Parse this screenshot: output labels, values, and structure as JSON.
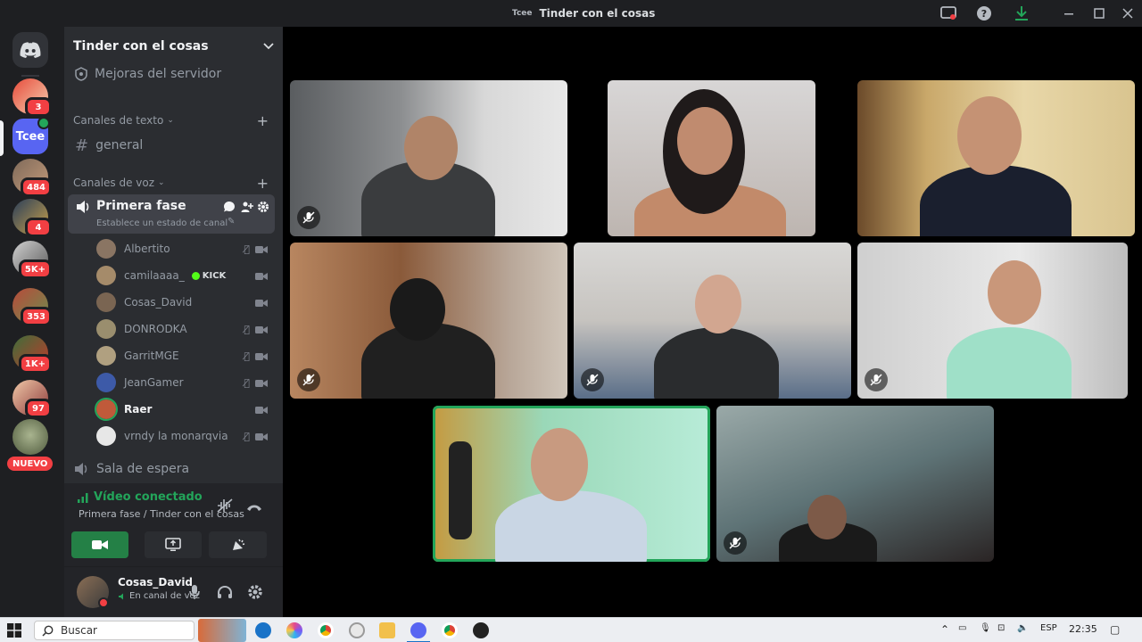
{
  "window": {
    "title": "Tinder con el cosas",
    "title_logo": "Tcee"
  },
  "rail": {
    "servers": [
      {
        "badge": "3",
        "color": "#c0392b"
      },
      {
        "label": "Tcee",
        "color": "#5865f2",
        "active": true
      },
      {
        "badge": "484",
        "color": "#7f6a5a"
      },
      {
        "badge": "4",
        "color": "#4f6f9a"
      },
      {
        "badge": "5K+",
        "color": "#a9a9a9"
      },
      {
        "badge": "353",
        "color": "#6b8e4e"
      },
      {
        "badge": "1K+",
        "color": "#3e6e3a"
      },
      {
        "badge": "97",
        "color": "#8b3a3a"
      },
      {
        "color": "#7d8a6a"
      }
    ],
    "new_label": "NUEVO"
  },
  "sidebar": {
    "server_name": "Tinder con el cosas",
    "boost": "Mejoras del servidor",
    "text_category": "Canales de texto",
    "text_channel": "general",
    "voice_category": "Canales de voz",
    "voice_channel": "Primera fase",
    "voice_status_prompt": "Establece un estado de canal",
    "voice_users": [
      {
        "name": "Albertito",
        "color": "#8a7563",
        "muted": true,
        "video": true
      },
      {
        "name": "camilaaaa_",
        "color": "#a58b6a",
        "kick": "KICK",
        "muted": false,
        "video": true
      },
      {
        "name": "Cosas_David",
        "color": "#7a6552",
        "muted": false,
        "video": true
      },
      {
        "name": "DONRODKA",
        "color": "#9a8e6e",
        "muted": true,
        "video": true
      },
      {
        "name": "GarritMGE",
        "color": "#b0a080",
        "muted": true,
        "video": true
      },
      {
        "name": "JeanGamer",
        "color": "#3d5aa8",
        "muted": true,
        "video": true
      },
      {
        "name": "Raer",
        "color": "#c05a3a",
        "muted": false,
        "video": true,
        "bold": true
      },
      {
        "name": "vrndy la monarqvia",
        "color": "#e7e7e7",
        "muted": true,
        "video": true
      }
    ],
    "waiting_room": "Sala de espera"
  },
  "voice_panel": {
    "status": "Vídeo conectado",
    "location": "Primera fase / Tinder con el cosas"
  },
  "user_panel": {
    "name": "Cosas_David",
    "status": "En canal de voz"
  },
  "taskbar": {
    "search_placeholder": "Buscar",
    "language": "ESP",
    "time": "22:35"
  },
  "colors": {
    "accent_green": "#23a55a",
    "danger": "#f23f43",
    "blurple": "#5865f2"
  }
}
